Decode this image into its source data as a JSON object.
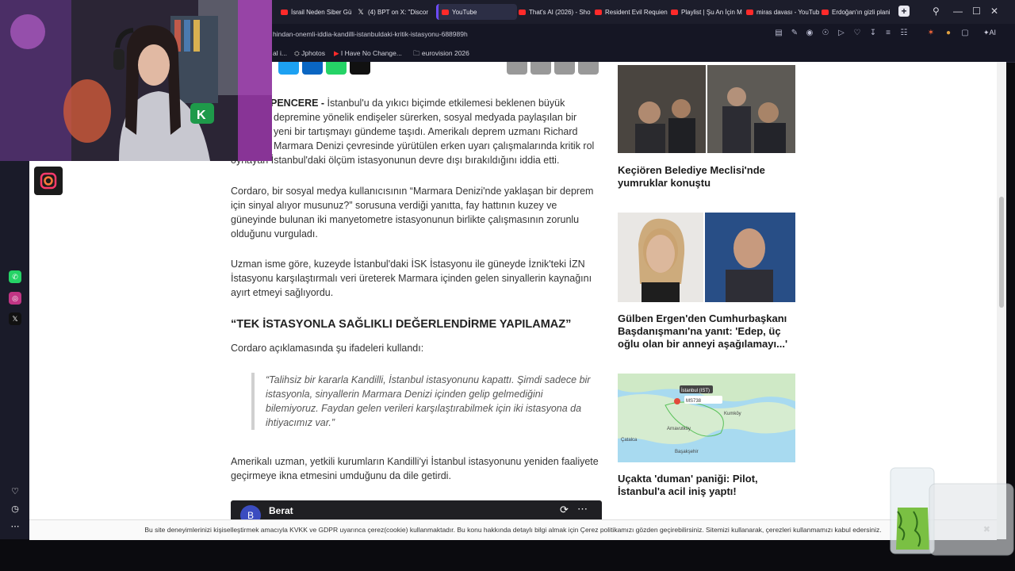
{
  "browser": {
    "tabs": [
      {
        "label": "İsrail Neden Siber Gü",
        "icon": "youtube-icon"
      },
      {
        "label": "(4) BPT on X: \"Discor",
        "icon": "x-icon"
      },
      {
        "label": "YouTube",
        "icon": "youtube-icon"
      },
      {
        "label": "That's AI (2026) - Sho",
        "icon": "youtube-icon"
      },
      {
        "label": "Resident Evil Requien",
        "icon": "youtube-icon"
      },
      {
        "label": "Playlist | Şu An İçin M",
        "icon": "youtube-icon"
      },
      {
        "label": "miras davası - YouTub",
        "icon": "youtube-icon"
      },
      {
        "label": "Erdoğan'ın gizli plani",
        "icon": "youtube-icon"
      }
    ],
    "new_tab": "+",
    "url": "hindan-onemli-iddia-kandilli-istanbuldaki-kritik-istasyonu-688989h",
    "ai_label": "AI",
    "bookmarks": [
      {
        "label": "al i..."
      },
      {
        "label": "Jphotos"
      },
      {
        "label": "I Have No Change..."
      },
      {
        "label": "eurovision 2026"
      }
    ]
  },
  "article": {
    "p1_lead": "PENCERE -",
    "p1_l1": " İstanbul'u da yıkıcı biçimde etkilemesi beklenen büyük",
    "p1_l2": "depremine yönelik endişeler sürerken, sosyal medyada paylaşılan bir",
    "p1_l3": "yeni bir tartışmayı gündeme taşıdı. Amerikalı deprem uzmanı Richard",
    "p1_l4": "Marmara Denizi çevresinde yürütülen erken uyarı çalışmalarında kritik rol",
    "p1_l5": "oynayan İstanbul'daki ölçüm istasyonunun devre dışı bırakıldığını iddia etti.",
    "p2": "Cordaro, bir sosyal medya kullanıcısının “Marmara Denizi'nde yaklaşan bir deprem için sinyal alıyor musunuz?” sorusuna verdiği yanıtta, fay hattının kuzey ve güneyinde bulunan iki manyetometre istasyonunun birlikte çalışmasının zorunlu olduğunu vurguladı.",
    "p3": "Uzman isme göre, kuzeyde İstanbul'daki İSK İstasyonu ile güneyde İznik'teki İZN İstasyonu karşılaştırmalı veri üreterek Marmara içinden gelen sinyallerin kaynağını ayırt etmeyi sağlıyordu.",
    "h2": "“TEK İSTASYONLA SAĞLIKLI DEĞERLENDİRME YAPILAMAZ”",
    "p4": "Cordaro açıklamasında şu ifadeleri kullandı:",
    "quote": "“Talihsiz bir kararla Kandilli, İstanbul istasyonunu kapattı. Şimdi sadece bir istasyonla, sinyallerin Marmara Denizi içinden gelip gelmediğini bilemiyoruz. Faydan gelen verileri karşılaştırabilmek için iki istasyona da ihtiyacımız var.”",
    "p5": "Amerikalı uzman, yetkili kurumların Kandilli'yi İstanbul istasyonunu yeniden faaliyete geçirmeye ikna etmesini umduğunu da dile getirdi.",
    "tweet_author": "Berat",
    "tweet_avatar": "B"
  },
  "sidebar_news": [
    {
      "title": "Keçiören Belediye Meclisi'nde yumruklar konuştu"
    },
    {
      "title": "Gülben Ergen'den Cumhurbaşkanı Başdanışmanı'na yanıt: 'Edep, üç oğlu olan bir anneyi aşağılamayı...'"
    },
    {
      "title": "Uçakta 'duman' paniği: Pilot, İstanbul'a acil iniş yaptı!"
    }
  ],
  "map_labels": {
    "city": "İstanbul (IST)",
    "flight": "MS738",
    "kumkoy": "Kumköy",
    "arnavutkoy": "Arnavutköy",
    "catalca": "Çatalca",
    "basaksehir": "Başakşehir"
  },
  "cookie_text": "Bu site deneyimlerinizi kişiselleştirmek amacıyla KVKK ve GDPR uyarınca çerez(cookie) kullanmaktadır. Bu konu hakkında detaylı bilgi almak için Çerez politikamızı gözden geçirebilirsiniz. Sitemizi kullanarak, çerezleri kullanmamızı kabul edersiniz.",
  "cookie_close": "✖",
  "colors": {
    "whatsapp": "#25d366",
    "instagram": "#c13584",
    "x": "#111111",
    "page_bg": "#ffffff",
    "chrome_bg": "#1c1d2b"
  }
}
